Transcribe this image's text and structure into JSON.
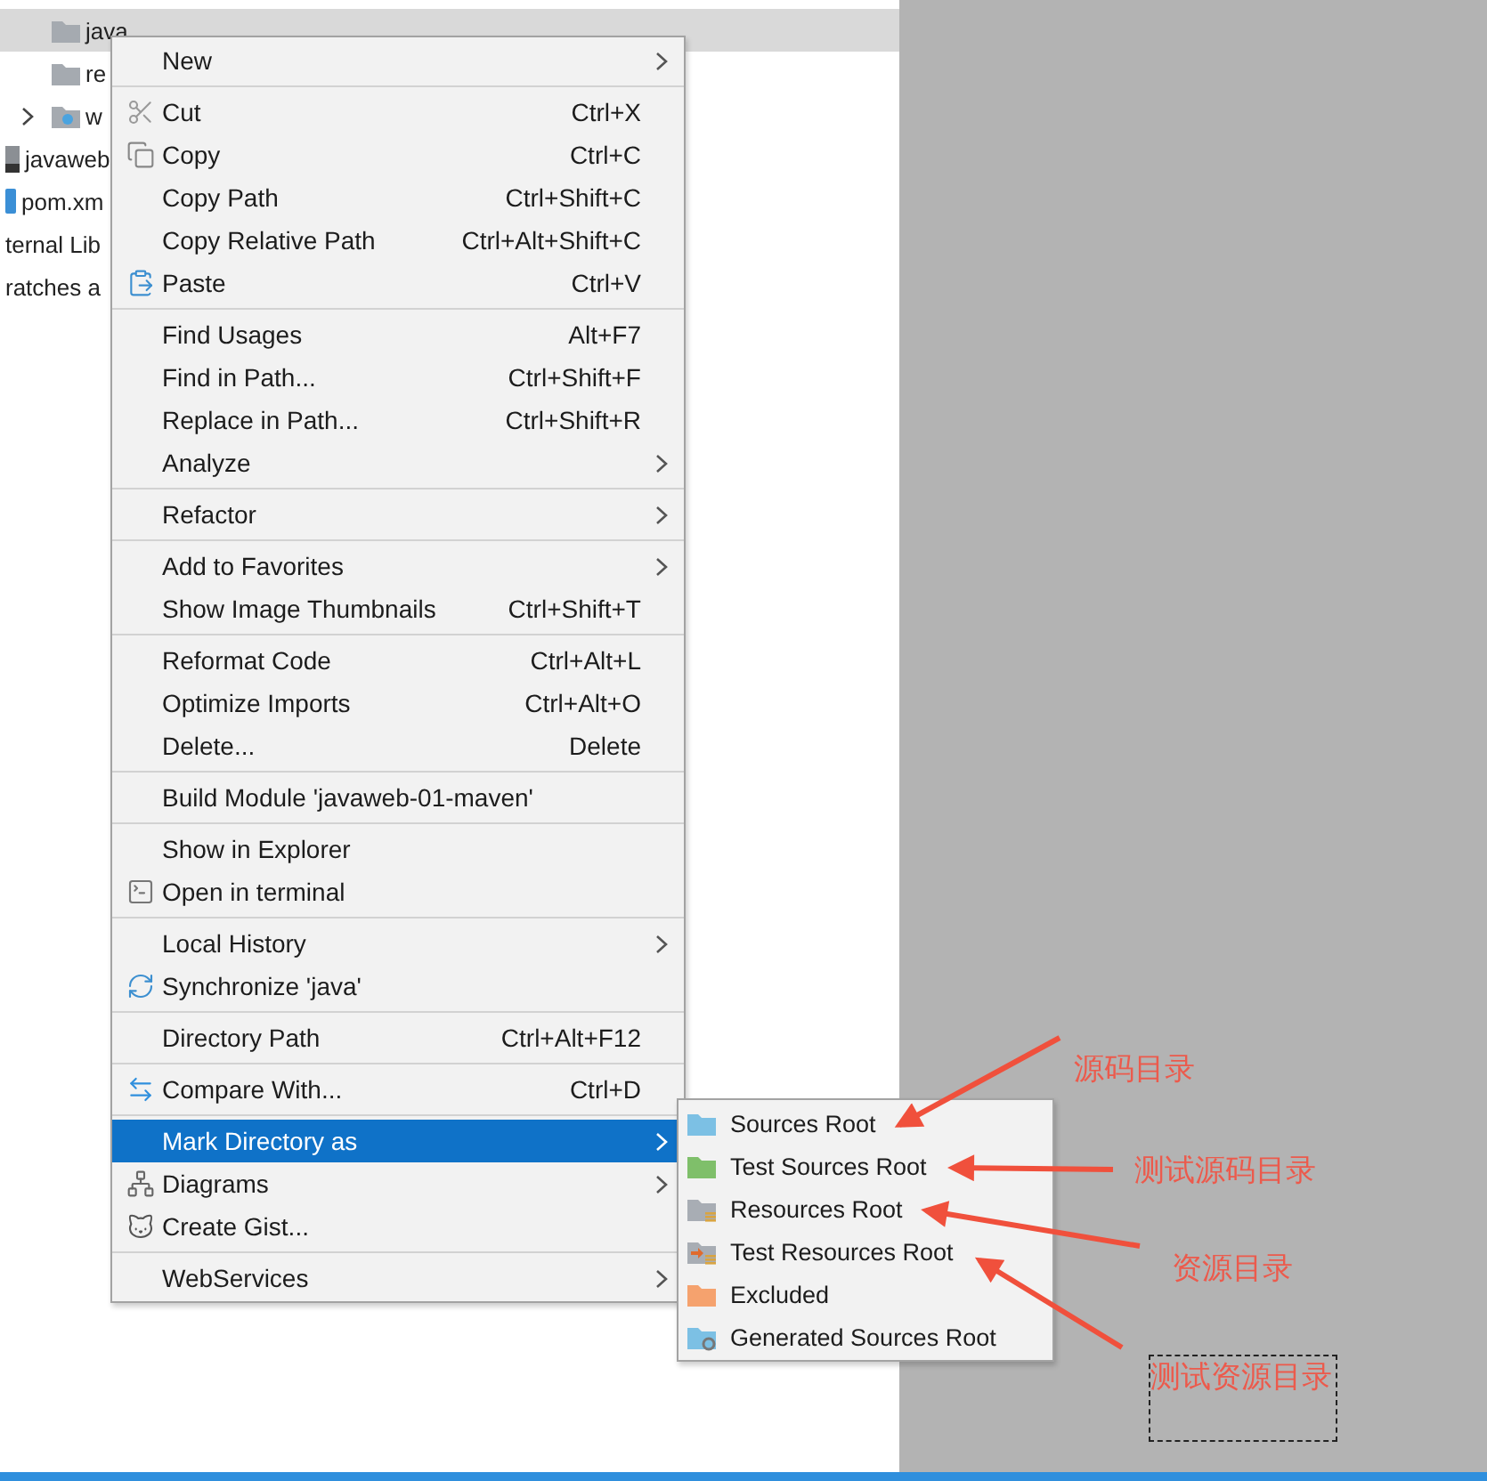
{
  "project_tree": {
    "items": [
      {
        "children": [
          {
            "label": "java",
            "kind": "folder",
            "selected": true,
            "collapsed": false
          },
          {
            "label": "re",
            "kind": "folder",
            "selected": false,
            "collapsed": false
          },
          {
            "label": "w",
            "kind": "web-folder",
            "selected": false,
            "collapsed": true
          }
        ]
      },
      {
        "label": "javaweb",
        "kind": "module-file",
        "selected": false,
        "collapsed": false
      },
      {
        "label": "pom.xm",
        "kind": "maven-file",
        "selected": false,
        "collapsed": false
      },
      {
        "label": "ternal Lib",
        "kind": "text",
        "selected": false,
        "collapsed": false
      },
      {
        "label": "ratches a",
        "kind": "text",
        "selected": false,
        "collapsed": false
      }
    ]
  },
  "context_menu": {
    "groups": [
      [
        {
          "label": "New",
          "submenu": true,
          "kind": "plain",
          "selected": false
        }
      ],
      [
        {
          "label": "Cut",
          "shortcut": "Ctrl+X",
          "submenu": false,
          "kind": "cut",
          "selected": false
        },
        {
          "label": "Copy",
          "shortcut": "Ctrl+C",
          "submenu": false,
          "kind": "copy",
          "selected": false
        },
        {
          "label": "Copy Path",
          "shortcut": "Ctrl+Shift+C",
          "submenu": false,
          "kind": "plain",
          "selected": false
        },
        {
          "label": "Copy Relative Path",
          "shortcut": "Ctrl+Alt+Shift+C",
          "submenu": false,
          "kind": "plain",
          "selected": false
        },
        {
          "label": "Paste",
          "shortcut": "Ctrl+V",
          "submenu": false,
          "kind": "paste",
          "selected": false
        }
      ],
      [
        {
          "label": "Find Usages",
          "shortcut": "Alt+F7",
          "submenu": false,
          "kind": "plain",
          "selected": false
        },
        {
          "label": "Find in Path...",
          "shortcut": "Ctrl+Shift+F",
          "submenu": false,
          "kind": "plain",
          "selected": false
        },
        {
          "label": "Replace in Path...",
          "shortcut": "Ctrl+Shift+R",
          "submenu": false,
          "kind": "plain",
          "selected": false
        },
        {
          "label": "Analyze",
          "submenu": true,
          "kind": "plain",
          "selected": false
        }
      ],
      [
        {
          "label": "Refactor",
          "submenu": true,
          "kind": "plain",
          "selected": false
        }
      ],
      [
        {
          "label": "Add to Favorites",
          "submenu": true,
          "kind": "plain",
          "selected": false
        },
        {
          "label": "Show Image Thumbnails",
          "shortcut": "Ctrl+Shift+T",
          "submenu": false,
          "kind": "plain",
          "selected": false
        }
      ],
      [
        {
          "label": "Reformat Code",
          "shortcut": "Ctrl+Alt+L",
          "submenu": false,
          "kind": "plain",
          "selected": false
        },
        {
          "label": "Optimize Imports",
          "shortcut": "Ctrl+Alt+O",
          "submenu": false,
          "kind": "plain",
          "selected": false
        },
        {
          "label": "Delete...",
          "shortcut": "Delete",
          "submenu": false,
          "kind": "plain",
          "selected": false
        }
      ],
      [
        {
          "label": "Build Module 'javaweb-01-maven'",
          "submenu": false,
          "kind": "plain",
          "selected": false
        }
      ],
      [
        {
          "label": "Show in Explorer",
          "submenu": false,
          "kind": "plain",
          "selected": false
        },
        {
          "label": "Open in terminal",
          "submenu": false,
          "kind": "terminal",
          "selected": false
        }
      ],
      [
        {
          "label": "Local History",
          "submenu": true,
          "kind": "plain",
          "selected": false
        },
        {
          "label": "Synchronize 'java'",
          "submenu": false,
          "kind": "sync",
          "selected": false
        }
      ],
      [
        {
          "label": "Directory Path",
          "shortcut": "Ctrl+Alt+F12",
          "submenu": false,
          "kind": "plain",
          "selected": false
        }
      ],
      [
        {
          "label": "Compare With...",
          "shortcut": "Ctrl+D",
          "submenu": false,
          "kind": "compare",
          "selected": false
        }
      ],
      [
        {
          "label": "Mark Directory as",
          "submenu": true,
          "kind": "plain",
          "selected": true
        },
        {
          "label": "Diagrams",
          "submenu": true,
          "kind": "diagram",
          "selected": false
        },
        {
          "label": "Create Gist...",
          "submenu": false,
          "kind": "gist",
          "selected": false
        }
      ],
      [
        {
          "label": "WebServices",
          "submenu": true,
          "kind": "plain",
          "selected": false
        }
      ]
    ]
  },
  "mark_submenu": [
    {
      "label": "Sources Root",
      "kind": "plain",
      "color": "#7cc0e4"
    },
    {
      "label": "Test Sources Root",
      "kind": "plain",
      "color": "#7fbf6a"
    },
    {
      "label": "Resources Root",
      "kind": "resources",
      "color": "#a8adb4"
    },
    {
      "label": "Test Resources Root",
      "kind": "test-resources",
      "color": "#a8adb4"
    },
    {
      "label": "Excluded",
      "kind": "plain",
      "color": "#f5a26e"
    },
    {
      "label": "Generated Sources Root",
      "kind": "generated",
      "color": "#7cc0e4"
    }
  ],
  "annotations": [
    {
      "text": "源码目录",
      "boxed": false
    },
    {
      "text": "测试源码目录",
      "boxed": false
    },
    {
      "text": "资源目录",
      "boxed": false
    },
    {
      "text": "测试资源目录",
      "boxed": true
    }
  ]
}
